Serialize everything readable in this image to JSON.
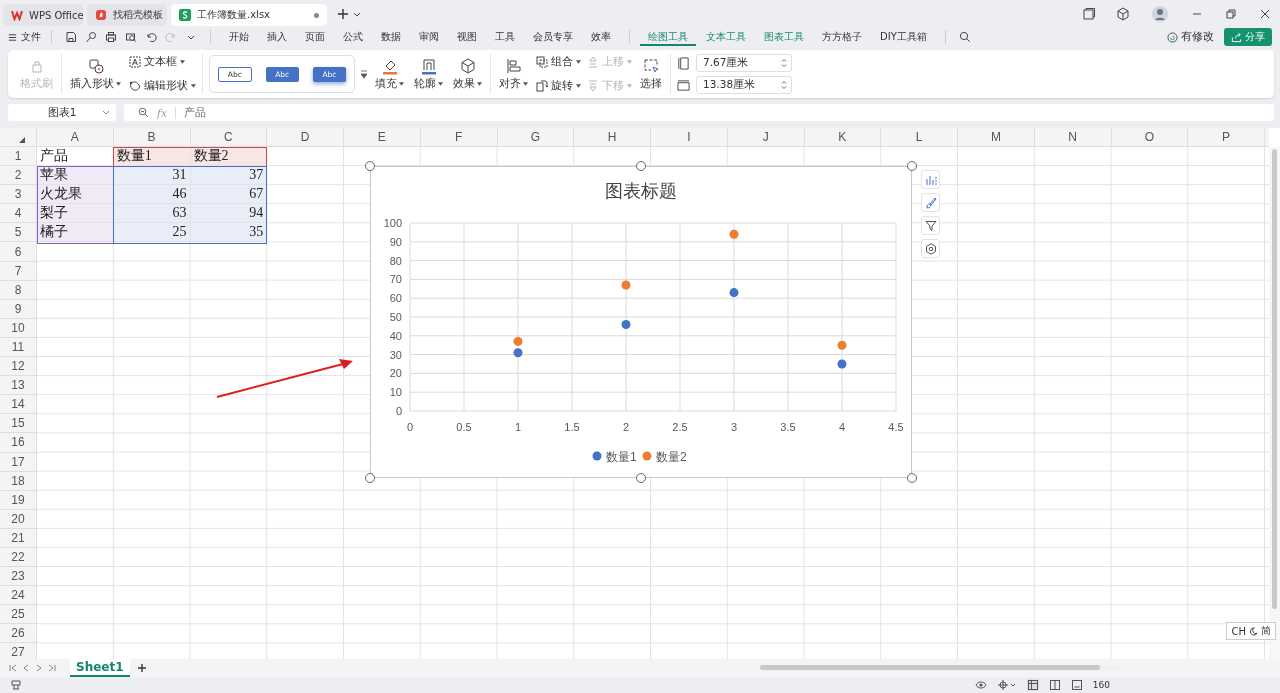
{
  "title_tabs": [
    {
      "label": "WPS Office",
      "kind": "wps",
      "selected": false
    },
    {
      "label": "找稻壳模板",
      "kind": "docer",
      "selected": false
    },
    {
      "label": "工作簿数量.xlsx",
      "kind": "sheet",
      "selected": true
    }
  ],
  "menu": {
    "file": "文件",
    "tabs": [
      {
        "label": "开始",
        "selected": false,
        "contextual": false
      },
      {
        "label": "插入",
        "selected": false,
        "contextual": false
      },
      {
        "label": "页面",
        "selected": false,
        "contextual": false
      },
      {
        "label": "公式",
        "selected": false,
        "contextual": false
      },
      {
        "label": "数据",
        "selected": false,
        "contextual": false
      },
      {
        "label": "审阅",
        "selected": false,
        "contextual": false
      },
      {
        "label": "视图",
        "selected": false,
        "contextual": false
      },
      {
        "label": "工具",
        "selected": false,
        "contextual": false
      },
      {
        "label": "会员专享",
        "selected": false,
        "contextual": false
      },
      {
        "label": "效率",
        "selected": false,
        "contextual": false
      },
      {
        "label": "绘图工具",
        "selected": true,
        "contextual": true
      },
      {
        "label": "文本工具",
        "selected": false,
        "contextual": true
      },
      {
        "label": "图表工具",
        "selected": false,
        "contextual": true
      },
      {
        "label": "方方格子",
        "selected": false,
        "contextual": false
      },
      {
        "label": "DIY工具箱",
        "selected": false,
        "contextual": false
      }
    ],
    "modified": "有修改",
    "share": "分享"
  },
  "ribbon": {
    "format_painter": {
      "label": "格式刷",
      "disabled": true
    },
    "insert_shape": {
      "label": "插入形状",
      "disabled": false
    },
    "text_box": {
      "label": "文本框",
      "disabled": false
    },
    "edit_shape": {
      "label": "编辑形状",
      "disabled": false
    },
    "styles": [
      {
        "label": "Abc",
        "kind": "outline"
      },
      {
        "label": "Abc",
        "kind": "filled"
      },
      {
        "label": "Abc",
        "kind": "glow"
      }
    ],
    "fill": {
      "label": "填充",
      "disabled": false
    },
    "outline": {
      "label": "轮廓",
      "disabled": false
    },
    "effect": {
      "label": "效果",
      "disabled": false
    },
    "align": {
      "label": "对齐",
      "disabled": false
    },
    "group": {
      "label": "组合",
      "disabled": false
    },
    "rotate": {
      "label": "旋转",
      "disabled": false
    },
    "bring_forward": {
      "label": "上移",
      "disabled": true
    },
    "send_backward": {
      "label": "下移",
      "disabled": true
    },
    "select": {
      "label": "选择",
      "disabled": false
    },
    "height_field": {
      "value": "7.67厘米"
    },
    "width_field": {
      "value": "13.38厘米"
    }
  },
  "formula_bar": {
    "name_box": "图表1",
    "fx": "fx",
    "content": "产品"
  },
  "sheet": {
    "columns": [
      "A",
      "B",
      "C",
      "D",
      "E",
      "F",
      "G",
      "H",
      "I",
      "J",
      "K",
      "L",
      "M",
      "N",
      "O",
      "P"
    ],
    "rows": [
      "1",
      "2",
      "3",
      "4",
      "5",
      "6",
      "7",
      "8",
      "9",
      "10",
      "11",
      "12",
      "13",
      "14",
      "15",
      "16",
      "17",
      "18",
      "19",
      "20",
      "21",
      "22",
      "23",
      "24",
      "25",
      "26",
      "27"
    ],
    "cells": [
      [
        "产品",
        "数量1",
        "数量2"
      ],
      [
        "苹果",
        "31",
        "37"
      ],
      [
        "火龙果",
        "46",
        "67"
      ],
      [
        "梨子",
        "63",
        "94"
      ],
      [
        "橘子",
        "25",
        "35"
      ]
    ]
  },
  "chart": {
    "chart_data": {
      "type": "scatter",
      "title": "图表标题",
      "x": [
        1,
        2,
        3,
        4
      ],
      "series": [
        {
          "name": "数量1",
          "color": "#4472c4",
          "values": [
            31,
            46,
            63,
            25
          ]
        },
        {
          "name": "数量2",
          "color": "#ed7d31",
          "values": [
            37,
            67,
            94,
            35
          ]
        }
      ],
      "xlim": [
        0,
        4.5
      ],
      "ylim": [
        0,
        100
      ],
      "xticks": [
        0,
        0.5,
        1,
        1.5,
        2,
        2.5,
        3,
        3.5,
        4,
        4.5
      ],
      "yticks": [
        0,
        10,
        20,
        30,
        40,
        50,
        60,
        70,
        80,
        90,
        100
      ],
      "grid": true,
      "legend": true
    }
  },
  "sheet_tabs": [
    {
      "label": "Sheet1",
      "selected": true
    }
  ],
  "ime": {
    "lang": "CH",
    "mode": "简"
  },
  "status_bar": {
    "zoom": "160"
  }
}
